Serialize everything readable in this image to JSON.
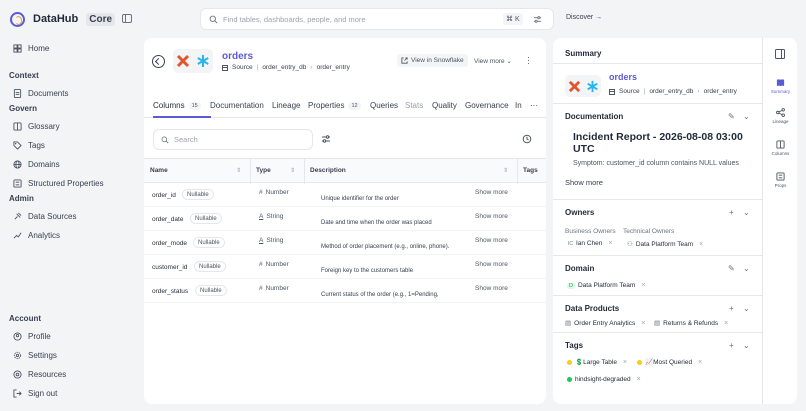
{
  "brand": {
    "name": "DataHub",
    "edition": "Core"
  },
  "nav": {
    "home": "Home",
    "context_header": "Context",
    "documents": "Documents",
    "govern_header": "Govern",
    "glossary": "Glossary",
    "tags": "Tags",
    "domains": "Domains",
    "structured_properties": "Structured Properties",
    "admin_header": "Admin",
    "data_sources": "Data Sources",
    "analytics": "Analytics",
    "account_header": "Account",
    "profile": "Profile",
    "settings": "Settings",
    "resources": "Resources",
    "sign_out": "Sign out"
  },
  "topbar": {
    "search_placeholder": "Find tables, dashboards, people, and more",
    "shortcut": "⌘ K",
    "discover": "Discover →"
  },
  "entity": {
    "title": "orders",
    "source_label": "Source",
    "path1": "order_entry_db",
    "path2": "order_entry",
    "view_in": "View in Snowflake",
    "view_more": "View more"
  },
  "tabs": {
    "columns": "Columns",
    "columns_count": "15",
    "documentation": "Documentation",
    "lineage": "Lineage",
    "properties": "Properties",
    "properties_count": "12",
    "queries": "Queries",
    "stats": "Stats",
    "quality": "Quality",
    "governance": "Governance",
    "incidents": "In",
    "more": "···"
  },
  "columns_table": {
    "search_placeholder": "Search",
    "headers": {
      "name": "Name",
      "type": "Type",
      "description": "Description",
      "tags": "Tags"
    },
    "show_more": "Show more",
    "rows": [
      {
        "name": "order_id",
        "nullable": "Nullable",
        "type": "Number",
        "description": "Unique identifier for the order"
      },
      {
        "name": "order_date",
        "nullable": "Nullable",
        "type": "String",
        "description": "Date and time when the order was placed"
      },
      {
        "name": "order_mode",
        "nullable": "Nullable",
        "type": "String",
        "description": "Method of order placement (e.g., online, phone)."
      },
      {
        "name": "customer_id",
        "nullable": "Nullable",
        "type": "Number",
        "description": "Foreign key to the customers table"
      },
      {
        "name": "order_status",
        "nullable": "Nullable",
        "type": "Number",
        "description": "Current status of the order (e.g., 1=Pending,"
      }
    ]
  },
  "summary": {
    "title": "Summary",
    "documentation_title": "Documentation",
    "incident_title": "Incident Report - 2026-08-08 03:00 UTC",
    "symptom": "Symptom: customer_id column contains NULL values",
    "show_more": "Show more",
    "owners_title": "Owners",
    "business_owners": "Business Owners",
    "technical_owners": "Technical Owners",
    "owner1": "Ian Chen",
    "owner1_initials": "IC",
    "owner2": "Data Platform Team",
    "domain_title": "Domain",
    "domain": "Data Platform Team",
    "domain_letter": "D",
    "data_products_title": "Data Products",
    "product1": "Order Entry Analytics",
    "product2": "Returns & Refunds",
    "tags_title": "Tags",
    "tag1": "💲Large Table",
    "tag2": "📈Most Queried",
    "tag3": "hindsight-degraded"
  },
  "rail": {
    "summary": "Summary",
    "lineage": "Lineage",
    "columns": "Columns",
    "props": "Props"
  },
  "colors": {
    "accent": "#5b5bd6",
    "bg": "#f3f4f6"
  }
}
